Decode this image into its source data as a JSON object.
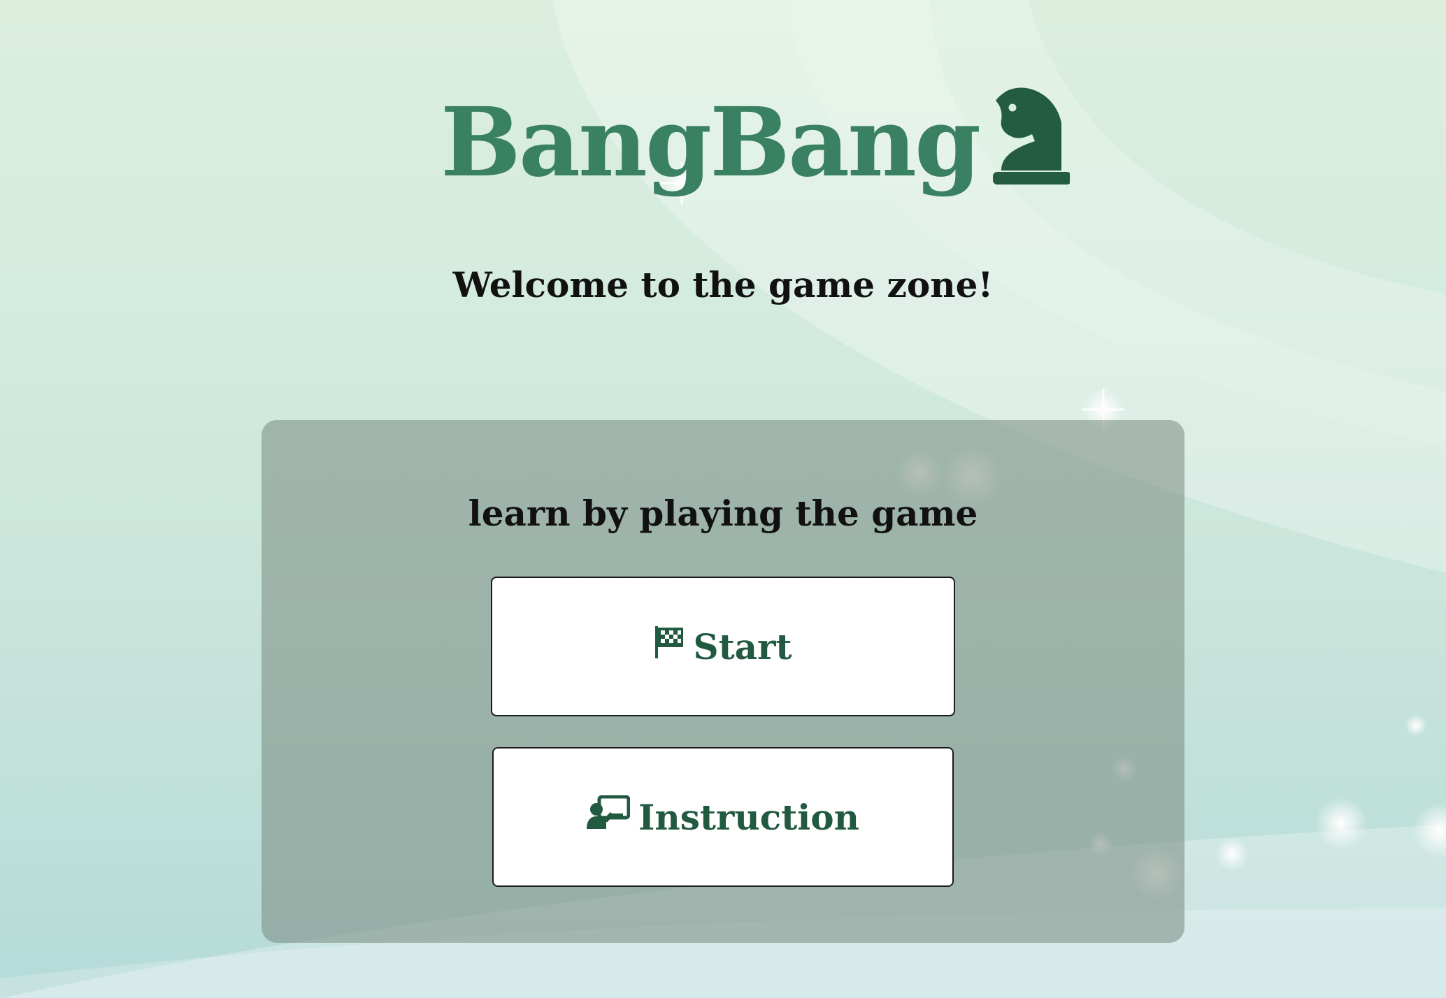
{
  "app": {
    "logo_text": "BangBang",
    "logo_icon": "chess-knight-icon",
    "brand_color": "#3a8062",
    "brand_dark_color": "#215a41"
  },
  "header": {
    "welcome": "Welcome to the game zone!"
  },
  "panel": {
    "subtitle": "learn by playing the game",
    "start_button": {
      "label": "Start",
      "icon": "checkered-flag-icon"
    },
    "instruction_button": {
      "label": "Instruction",
      "icon": "teacher-board-icon"
    }
  }
}
